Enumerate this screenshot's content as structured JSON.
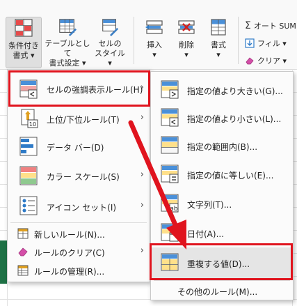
{
  "ribbon": {
    "cond_format": {
      "line1": "条件付き",
      "line2": "書式 ▾"
    },
    "table_format": {
      "line1": "テーブルとして",
      "line2": "書式設定 ▾"
    },
    "cell_style": {
      "line1": "セルの",
      "line2": "スタイル ▾"
    },
    "insert": {
      "line1": "挿入",
      "line2": "▾"
    },
    "delete": {
      "line1": "削除",
      "line2": "▾"
    },
    "format": {
      "line1": "書式",
      "line2": "▾"
    },
    "autosum": "オート SUM",
    "fill": "フィル ▾",
    "clear": "クリア ▾"
  },
  "main_menu": {
    "items": [
      {
        "label": "セルの強調表示ルール(H)",
        "icon": "highlight-rules-icon",
        "has_submenu": true
      },
      {
        "label": "上位/下位ルール(T)",
        "icon": "top-bottom-rules-icon",
        "has_submenu": true
      },
      {
        "label": "データ バー(D)",
        "icon": "data-bars-icon",
        "has_submenu": true
      },
      {
        "label": "カラー スケール(S)",
        "icon": "color-scales-icon",
        "has_submenu": true
      },
      {
        "label": "アイコン セット(I)",
        "icon": "icon-sets-icon",
        "has_submenu": true
      }
    ],
    "bottom_items": [
      {
        "label": "新しいルール(N)...",
        "icon": "new-rule-icon"
      },
      {
        "label": "ルールのクリア(C)",
        "icon": "clear-rules-icon",
        "has_submenu": true
      },
      {
        "label": "ルールの管理(R)...",
        "icon": "manage-rules-icon"
      }
    ]
  },
  "sub_menu": {
    "items": [
      {
        "label": "指定の値より大きい(G)...",
        "icon": "greater-than-icon"
      },
      {
        "label": "指定の値より小さい(L)...",
        "icon": "less-than-icon"
      },
      {
        "label": "指定の範囲内(B)...",
        "icon": "between-icon"
      },
      {
        "label": "指定の値に等しい(E)...",
        "icon": "equal-to-icon"
      },
      {
        "label": "文字列(T)...",
        "icon": "text-contains-icon"
      },
      {
        "label": "日付(A)...",
        "icon": "date-occurring-icon"
      },
      {
        "label": "重複する値(D)...",
        "icon": "duplicate-values-icon"
      }
    ],
    "more_rules": "その他のルール(M)..."
  },
  "colors": {
    "highlight_red": "#e0141e",
    "accent_blue": "#2f7bc7",
    "cell_red": "#f2a6a6",
    "cell_yellow": "#ffe08a"
  }
}
